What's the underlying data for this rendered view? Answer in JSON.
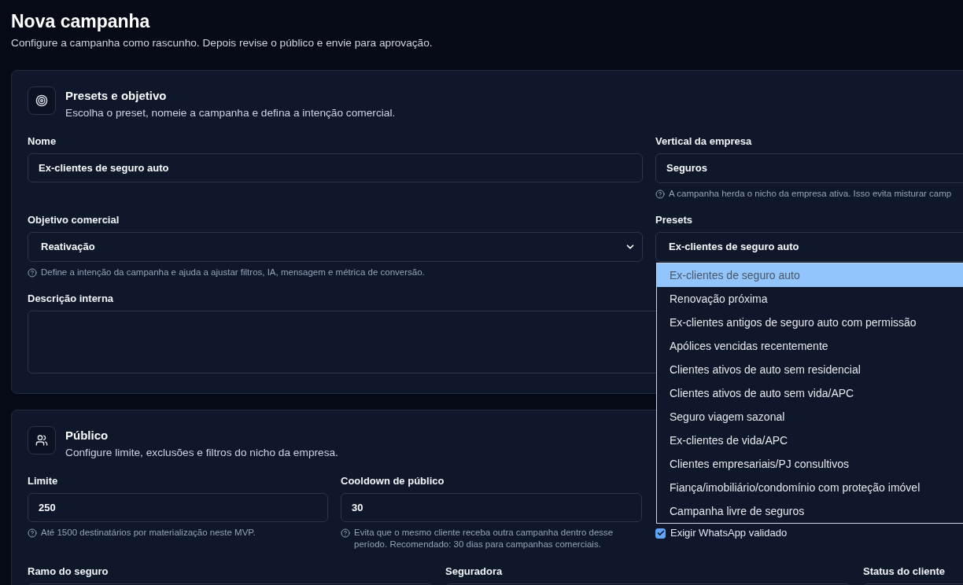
{
  "header": {
    "title": "Nova campanha",
    "subtitle": "Configure a campanha como rascunho. Depois revise o público e envie para aprovação."
  },
  "presets_section": {
    "title": "Presets e objetivo",
    "description": "Escolha o preset, nomeie a campanha e defina a intenção comercial.",
    "name_field": {
      "label": "Nome",
      "value": "Ex-clientes de seguro auto"
    },
    "vertical_field": {
      "label": "Vertical da empresa",
      "value": "Seguros",
      "hint": "A campanha herda o nicho da empresa ativa. Isso evita misturar camp"
    },
    "objective_field": {
      "label": "Objetivo comercial",
      "value": "Reativação",
      "hint": "Define a intenção da campanha e ajuda a ajustar filtros, IA, mensagem e métrica de conversão."
    },
    "presets_field": {
      "label": "Presets",
      "value": "Ex-clientes de seguro auto",
      "expanded": true,
      "options": [
        {
          "label": "Ex-clientes de seguro auto",
          "selected": true
        },
        {
          "label": "Renovação próxima",
          "selected": false
        },
        {
          "label": "Ex-clientes antigos de seguro auto com permissão",
          "selected": false
        },
        {
          "label": "Apólices vencidas recentemente",
          "selected": false
        },
        {
          "label": "Clientes ativos de auto sem residencial",
          "selected": false
        },
        {
          "label": "Clientes ativos de auto sem vida/APC",
          "selected": false
        },
        {
          "label": "Seguro viagem sazonal",
          "selected": false
        },
        {
          "label": "Ex-clientes de vida/APC",
          "selected": false
        },
        {
          "label": "Clientes empresariais/PJ consultivos",
          "selected": false
        },
        {
          "label": "Fiança/imobiliário/condomínio com proteção imóvel",
          "selected": false
        },
        {
          "label": "Campanha livre de seguros",
          "selected": false
        }
      ]
    },
    "description_field": {
      "label": "Descrição interna"
    }
  },
  "audience_section": {
    "title": "Público",
    "description": "Configure limite, exclusões e filtros do nicho da empresa.",
    "limit_field": {
      "label": "Limite",
      "value": "250",
      "hint": "Até 1500 destinatários por materialização neste MVP."
    },
    "cooldown_field": {
      "label": "Cooldown de público",
      "value": "30",
      "hint": "Evita que o mesmo cliente receba outra campanha dentro desse período. Recomendado: 30 dias para campanhas comerciais."
    },
    "whatsapp_checkbox": {
      "label": "Exigir WhatsApp validado",
      "checked": true
    },
    "filters": [
      {
        "label": "Ramo do seguro"
      },
      {
        "label": "Seguradora"
      },
      {
        "label": "Status do cliente"
      }
    ]
  }
}
